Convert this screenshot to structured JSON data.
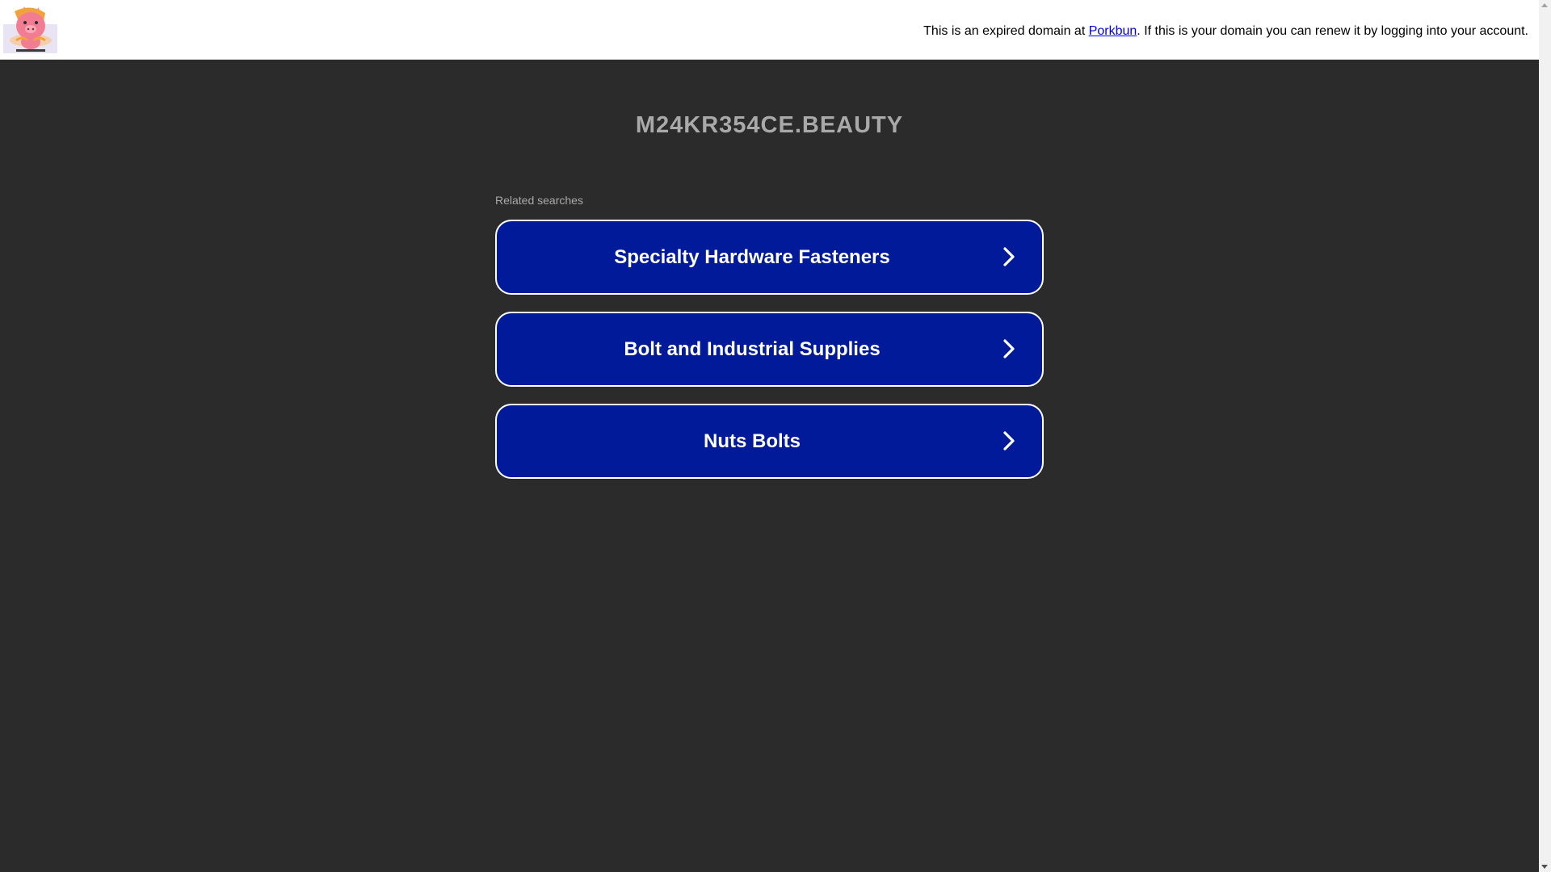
{
  "header": {
    "notice_before": "This is an expired domain at ",
    "notice_link": "Porkbun",
    "notice_after": ". If this is your domain you can renew it by logging into your account.",
    "logo_icon": "porkbun-pig-logo-icon"
  },
  "main": {
    "domain_title": "M24KR354CE.BEAUTY",
    "related_label": "Related searches",
    "searches": [
      {
        "label": "Specialty Hardware Fasteners",
        "icon": "chevron-right-icon"
      },
      {
        "label": "Bolt and Industrial Supplies",
        "icon": "chevron-right-icon"
      },
      {
        "label": "Nuts Bolts",
        "icon": "chevron-right-icon"
      }
    ]
  },
  "colors": {
    "background": "#2b2b2b",
    "button_fill": "#001a99",
    "button_border": "#ffffff",
    "title_text": "#a9a9a9",
    "link": "#0000ee"
  }
}
